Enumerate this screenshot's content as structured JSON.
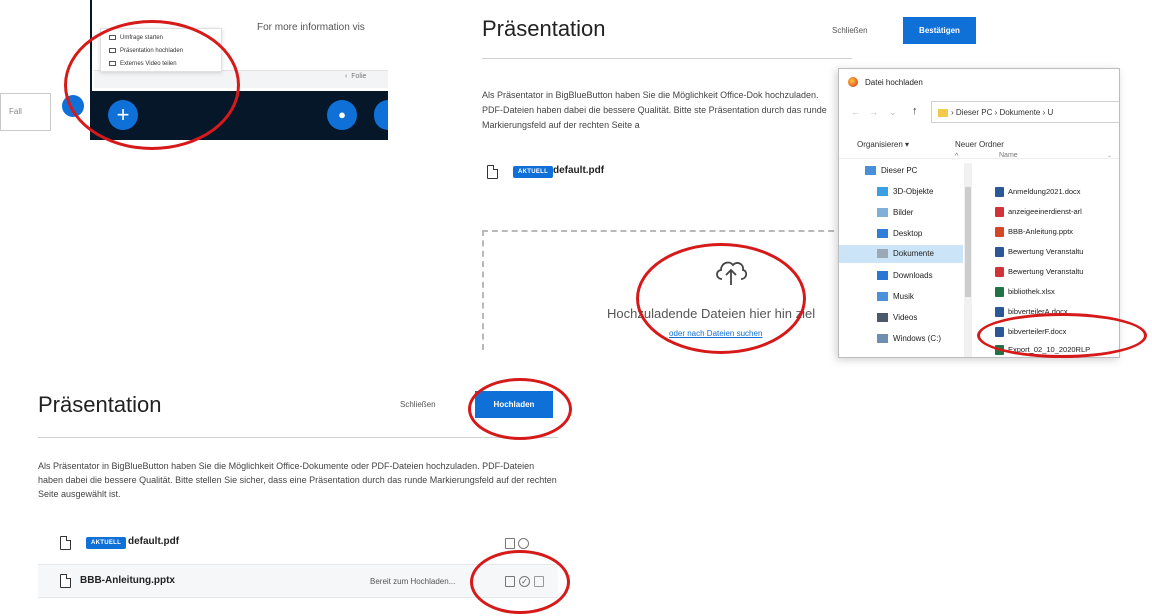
{
  "panel1": {
    "input_placeholder": "Fall",
    "info_text": "For more information vis",
    "gray_bar_text": "Folie",
    "menu_items": [
      {
        "label": "Umfrage starten",
        "icon": "poll-icon"
      },
      {
        "label": "Präsentation hochladen",
        "icon": "presentation-icon"
      },
      {
        "label": "Externes Video teilen",
        "icon": "video-icon"
      }
    ],
    "plus_glyph": "+",
    "mic_glyph": "🎙"
  },
  "panel2": {
    "title": "Präsentation",
    "close_label": "Schließen",
    "confirm_label": "Bestätigen",
    "description": "Als Präsentator in BigBlueButton haben Sie die Möglichkeit Office-Dok hochzuladen. PDF-Dateien haben dabei die bessere Qualität. Bitte ste Präsentation durch das runde Markierungsfeld auf der rechten Seite a",
    "badge": "AKTUELL",
    "file_name": "default.pdf",
    "drop_text": "Hochzuladende Dateien hier hin ziel",
    "drop_link": "oder nach Dateien suchen"
  },
  "dialog": {
    "title": "Datei hochladen",
    "path": [
      "Dieser PC",
      "Dokumente",
      "U"
    ],
    "organize_label": "Organisieren ▾",
    "new_folder_label": "Neuer Ordner",
    "column_name": "Name",
    "tree": [
      {
        "label": "Dieser PC",
        "color": "#4a90d9"
      },
      {
        "label": "3D-Objekte",
        "color": "#3aa0e0"
      },
      {
        "label": "Bilder",
        "color": "#7fb0d8"
      },
      {
        "label": "Desktop",
        "color": "#2f7fd8"
      },
      {
        "label": "Dokumente",
        "color": "#9aa8b8"
      },
      {
        "label": "Downloads",
        "color": "#2a78d4"
      },
      {
        "label": "Musik",
        "color": "#4d8fd8"
      },
      {
        "label": "Videos",
        "color": "#4a5a6a"
      },
      {
        "label": "Windows (C:)",
        "color": "#6f8fb0"
      }
    ],
    "files": [
      {
        "name": "Anmeldung2021.docx",
        "color": "#2b5797"
      },
      {
        "name": "anzeigeeinerdienst-arl",
        "color": "#d13438"
      },
      {
        "name": "BBB-Anleitung.pptx",
        "color": "#d24726"
      },
      {
        "name": "Bewertung Veranstaltu",
        "color": "#2b5797"
      },
      {
        "name": "Bewertung Veranstaltu",
        "color": "#d13438"
      },
      {
        "name": "bibliothek.xlsx",
        "color": "#217346"
      },
      {
        "name": "bibverteilerA.docx",
        "color": "#2b5797"
      },
      {
        "name": "bibverteilerF.docx",
        "color": "#2b5797"
      },
      {
        "name": "Export_02_10_2020RLP",
        "color": "#217346"
      }
    ]
  },
  "panel3": {
    "title": "Präsentation",
    "close_label": "Schließen",
    "upload_label": "Hochladen",
    "description": "Als Präsentator in BigBlueButton haben Sie die Möglichkeit Office-Dokumente oder PDF-Dateien hochzuladen. PDF-Dateien haben dabei die bessere Qualität. Bitte stellen Sie sicher, dass eine Präsentation durch das runde Markierungsfeld auf der rechten Seite ausgewählt ist.",
    "row1": {
      "badge": "AKTUELL",
      "file_name": "default.pdf"
    },
    "row2": {
      "file_name": "BBB-Anleitung.pptx",
      "status": "Bereit zum Hochladen..."
    }
  },
  "colors": {
    "accent": "#0f70d7",
    "annotation": "#d61a1a",
    "bar_dark": "#06172a"
  }
}
